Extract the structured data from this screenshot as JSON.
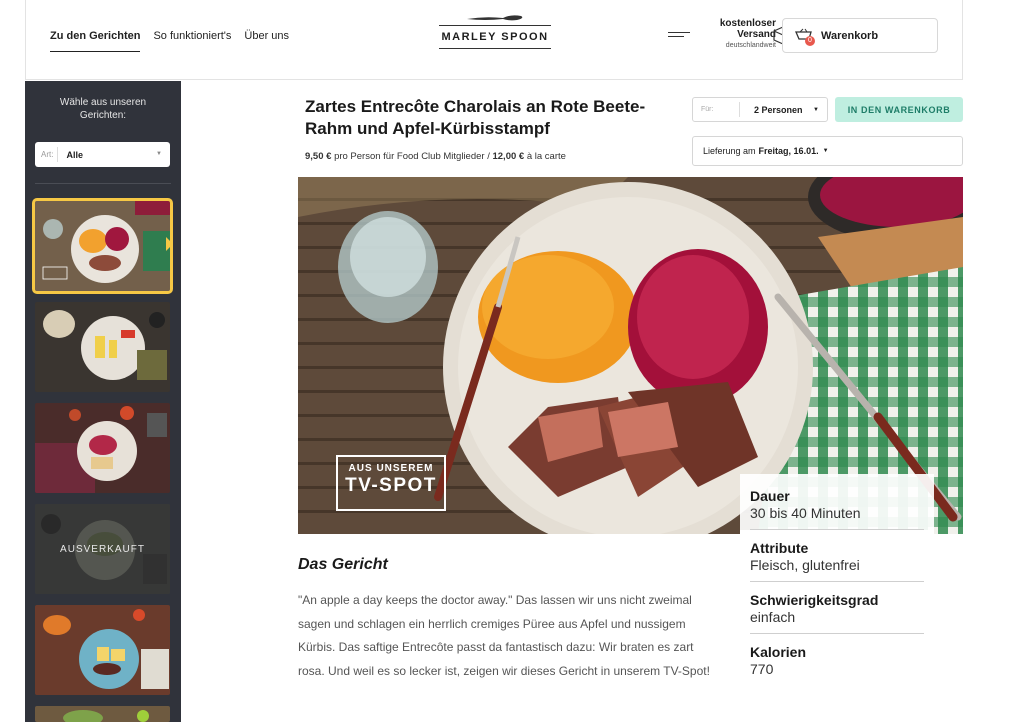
{
  "header": {
    "nav": [
      "Zu den Gerichten",
      "So funktioniert's",
      "Über uns"
    ],
    "logo_text": "MARLEY SPOON",
    "shipping": {
      "line1": "kostenloser",
      "line2": "Versand",
      "line3": "deutschlandweit"
    },
    "cart": {
      "label": "Warenkorb",
      "count": "0"
    }
  },
  "sidebar": {
    "hint": "Wähle aus unseren Gerichten:",
    "filter": {
      "label": "Art:",
      "value": "Alle"
    },
    "thumbs": [
      {
        "active": true,
        "soldout": ""
      },
      {
        "active": false,
        "soldout": ""
      },
      {
        "active": false,
        "soldout": ""
      },
      {
        "active": false,
        "soldout": "AUSVERKAUFT"
      },
      {
        "active": false,
        "soldout": ""
      }
    ]
  },
  "recipe": {
    "title": "Zartes Entrecôte Charolais an Rote Beete-Rahm und Apfel-Kürbisstampf",
    "price": {
      "member_price": "9,50 €",
      "member_text": "pro Person für Food Club Mitglieder /",
      "carte_price": "12,00 €",
      "carte_text": "à la carte"
    },
    "persons": {
      "label": "Für:",
      "value": "2 Personen"
    },
    "add_button": "IN DEN WARENKORB",
    "delivery": {
      "label": "Lieferung am",
      "value": "Freitag, 16.01."
    },
    "tv_badge": {
      "line1": "AUS UNSEREM",
      "line2": "TV-SPOT"
    },
    "facts": [
      {
        "key": "Dauer",
        "value": "30 bis 40 Minuten"
      },
      {
        "key": "Attribute",
        "value": "Fleisch, glutenfrei"
      },
      {
        "key": "Schwierigkeitsgrad",
        "value": "einfach"
      },
      {
        "key": "Kalorien",
        "value": "770"
      }
    ],
    "section_heading": "Das Gericht",
    "description": "\"An apple a day keeps the doctor away.\" Das lassen wir uns nicht zweimal sagen und schlagen ein herrlich cremiges Püree aus Apfel und nussigem Kürbis. Das saftige Entrecôte passt da fantastisch dazu: Wir braten es zart rosa. Und weil es so lecker ist, zeigen wir dieses Gericht in unserem TV-Spot!"
  },
  "colors": {
    "accent": "#bfeee0",
    "sidebar": "#30333b",
    "highlight": "#f6c845",
    "badge": "#e8584d"
  }
}
